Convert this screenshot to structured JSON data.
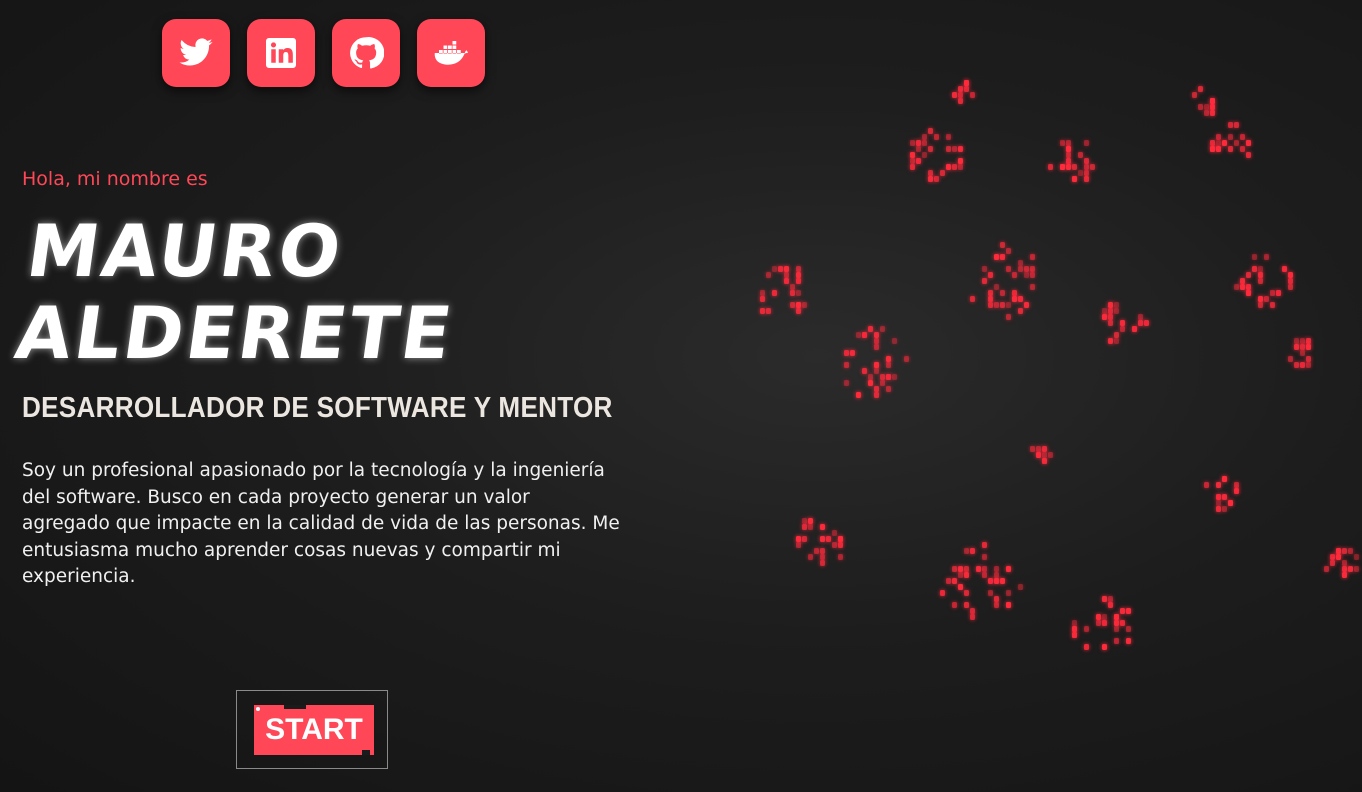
{
  "social": [
    {
      "icon": "twitter-icon"
    },
    {
      "icon": "linkedin-icon"
    },
    {
      "icon": "github-icon"
    },
    {
      "icon": "docker-icon"
    }
  ],
  "hero": {
    "greeting": "Hola, mi nombre es",
    "name_line1": "MAURO",
    "name_line2": "ALDERETE",
    "role": "DESARROLLADOR DE SOFTWARE Y MENTOR",
    "bio": "Soy un profesional apasionado por la tecnología y la ingeniería del software. Busco en cada proyecto generar un valor agregado que impacte en la calidad de vida de las personas. Me entusiasma mucho aprender cosas nuevas y compartir mi experiencia."
  },
  "cta": {
    "label": "START"
  },
  "colors": {
    "accent": "#ff4757",
    "background": "#1d1d1d",
    "text": "#ffffff"
  }
}
